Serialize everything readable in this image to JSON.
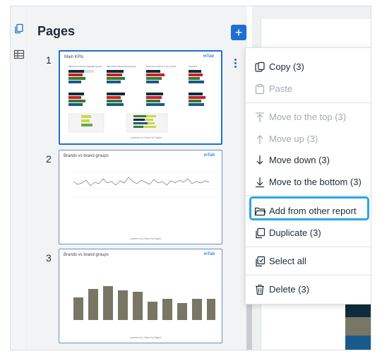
{
  "panel": {
    "title": "Pages"
  },
  "pages": [
    {
      "number": "1",
      "title": "Main KPIs",
      "logo": "mTab",
      "footer": "powered by Orient by Digital",
      "kpi_titles": [
        "Mean Perc Demol vegetable goods",
        "Mean Perc Demol bread goods",
        "Mean Perc Add % in 12 months",
        "Freshli B"
      ]
    },
    {
      "number": "2",
      "title": "Brands vs brand groups",
      "logo": "mTab",
      "footer": "powered by Orient by Digital"
    },
    {
      "number": "3",
      "title": "Brands vs brand groups",
      "logo": "mTab",
      "footer": "powered by Orient by Digital"
    }
  ],
  "menu": {
    "items": [
      {
        "label": "Copy (3)",
        "icon": "copy-icon",
        "enabled": true
      },
      {
        "label": "Paste",
        "icon": "paste-icon",
        "enabled": false
      },
      {
        "label": "Move to the top (3)",
        "icon": "arrow-to-top-icon",
        "enabled": false
      },
      {
        "label": "Move up (3)",
        "icon": "arrow-up-icon",
        "enabled": false
      },
      {
        "label": "Move down (3)",
        "icon": "arrow-down-icon",
        "enabled": true
      },
      {
        "label": "Move to the bottom (3)",
        "icon": "arrow-to-bottom-icon",
        "enabled": true
      },
      {
        "label": "Add from other report",
        "icon": "folder-icon",
        "enabled": true,
        "highlighted": true
      },
      {
        "label": "Duplicate (3)",
        "icon": "duplicate-icon",
        "enabled": true
      },
      {
        "label": "Select all",
        "icon": "select-all-icon",
        "enabled": true
      },
      {
        "label": "Delete (3)",
        "icon": "trash-icon",
        "enabled": true
      }
    ]
  },
  "colors": {
    "accent": "#1e6fd1",
    "highlight": "#29a8df",
    "bar": "#7a7665"
  }
}
